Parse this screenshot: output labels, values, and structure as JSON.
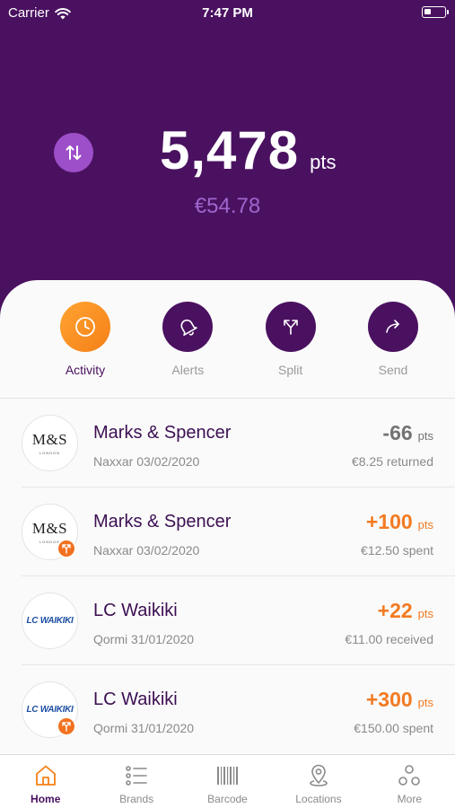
{
  "status_bar": {
    "carrier": "Carrier",
    "time": "7:47 PM"
  },
  "balance": {
    "points": "5,478",
    "unit": "pts",
    "euro_value": "€54.78"
  },
  "colors": {
    "primary_purple": "#4a1160",
    "accent_orange": "#f58018",
    "swap_button": "#9d4ec9",
    "euro_text": "#a065cc"
  },
  "actions": [
    {
      "label": "Activity",
      "icon": "clock-icon",
      "active": true
    },
    {
      "label": "Alerts",
      "icon": "bell-icon",
      "active": false
    },
    {
      "label": "Split",
      "icon": "split-icon",
      "active": false
    },
    {
      "label": "Send",
      "icon": "send-arrow-icon",
      "active": false
    }
  ],
  "transactions": [
    {
      "merchant": "Marks & Spencer",
      "location": "Naxxar",
      "date": "03/02/2020",
      "meta": "Naxxar 03/02/2020",
      "points": "-66",
      "unit": "pts",
      "amount": "€8.25 returned",
      "logo_text": "M&S",
      "logo_subtext": "LONDON",
      "has_badge": false
    },
    {
      "merchant": "Marks & Spencer",
      "location": "Naxxar",
      "date": "03/02/2020",
      "meta": "Naxxar 03/02/2020",
      "points": "+100",
      "unit": "pts",
      "amount": "€12.50 spent",
      "logo_text": "M&S",
      "logo_subtext": "LONDON",
      "has_badge": true
    },
    {
      "merchant": "LC Waikiki",
      "location": "Qormi",
      "date": "31/01/2020",
      "meta": "Qormi 31/01/2020",
      "points": "+22",
      "unit": "pts",
      "amount": "€11.00 received",
      "logo_text": "LC WAIKIKI",
      "has_badge": false
    },
    {
      "merchant": "LC Waikiki",
      "location": "Qormi",
      "date": "31/01/2020",
      "meta": "Qormi 31/01/2020",
      "points": "+300",
      "unit": "pts",
      "amount": "€150.00 spent",
      "logo_text": "LC WAIKIKI",
      "has_badge": true
    }
  ],
  "tabs": [
    {
      "label": "Home",
      "icon": "home-icon",
      "active": true
    },
    {
      "label": "Brands",
      "icon": "list-icon",
      "active": false
    },
    {
      "label": "Barcode",
      "icon": "barcode-icon",
      "active": false
    },
    {
      "label": "Locations",
      "icon": "location-pin-icon",
      "active": false
    },
    {
      "label": "More",
      "icon": "more-dots-icon",
      "active": false
    }
  ]
}
